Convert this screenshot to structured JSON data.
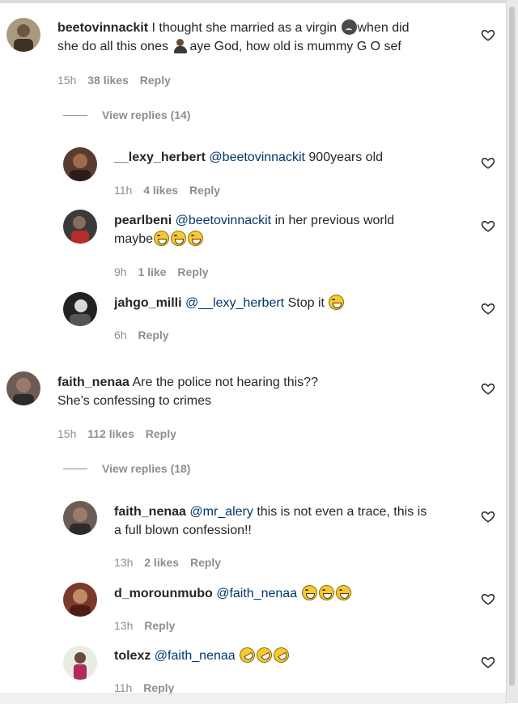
{
  "comments": [
    {
      "username": "beetovinnackit",
      "text_line1": "I thought she married as a virgin",
      "text_after_emoji1": "when did",
      "text_line2": "she do all this ones",
      "text_after_emoji2": "aye God, how old is mummy G O sef",
      "emoji1": "worried-face-emoji",
      "emoji2": "person-emoji",
      "time": "15h",
      "likes": "38 likes",
      "reply": "Reply",
      "view_replies": "View replies (14)",
      "replies": [
        {
          "username": "__lexy_herbert",
          "mention": "@beetovinnackit",
          "text": "900years old",
          "time": "11h",
          "likes": "4 likes",
          "reply": "Reply"
        },
        {
          "username": "pearlbeni",
          "mention": "@beetovinnackit",
          "text": "in her previous world",
          "text_line2": "maybe",
          "emojis": [
            "laugh",
            "laugh",
            "laugh"
          ],
          "time": "9h",
          "likes": "1 like",
          "reply": "Reply"
        },
        {
          "username": "jahgo_milli",
          "mention": "@__lexy_herbert",
          "text": "Stop it",
          "emojis": [
            "laugh"
          ],
          "time": "6h",
          "reply": "Reply"
        }
      ]
    },
    {
      "username": "faith_nenaa",
      "text_line1": "Are the police not hearing this??",
      "text_line2": "She’s confessing to crimes",
      "time": "15h",
      "likes": "112 likes",
      "reply": "Reply",
      "view_replies": "View replies (18)",
      "replies": [
        {
          "username": "faith_nenaa",
          "mention": "@mr_alery",
          "text": "this is not even a trace, this is",
          "text_line2": "a full blown confession!!",
          "time": "13h",
          "likes": "2 likes",
          "reply": "Reply"
        },
        {
          "username": "d_morounmubo",
          "mention": "@faith_nenaa",
          "text": "",
          "emojis": [
            "laugh",
            "laugh",
            "laugh"
          ],
          "time": "13h",
          "reply": "Reply"
        },
        {
          "username": "tolexz",
          "mention": "@faith_nenaa",
          "text": "",
          "emojis": [
            "rofl",
            "rofl",
            "rofl"
          ],
          "time": "11h",
          "reply": "Reply"
        }
      ]
    }
  ],
  "colors": {
    "text": "#262626",
    "meta": "#8e8e8e",
    "mention": "#00376b"
  },
  "icons": [
    "heart-icon"
  ]
}
